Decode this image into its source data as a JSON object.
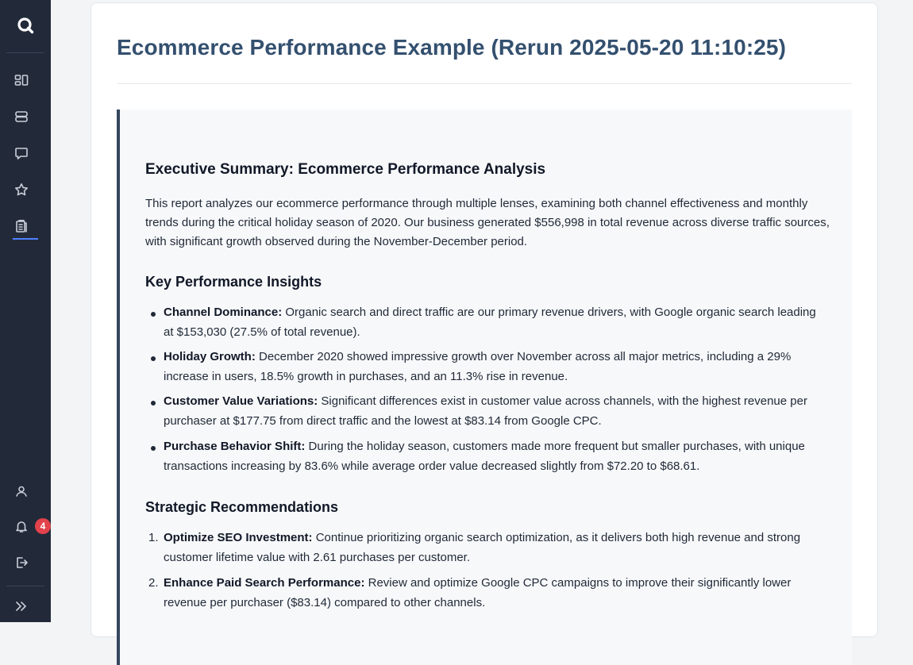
{
  "sidebar": {
    "items": [
      {
        "name": "dashboard-icon"
      },
      {
        "name": "database-icon"
      },
      {
        "name": "chat-icon"
      },
      {
        "name": "star-icon"
      },
      {
        "name": "reports-icon"
      }
    ],
    "bottom": [
      {
        "name": "user-icon"
      },
      {
        "name": "bell-icon"
      },
      {
        "name": "logout-icon"
      },
      {
        "name": "expand-icon"
      }
    ],
    "notification_count": "4",
    "accent_color": "#4f7fff"
  },
  "page": {
    "title": "Ecommerce Performance Example (Rerun 2025-05-20 11:10:25)"
  },
  "report": {
    "summary_heading": "Executive Summary: Ecommerce Performance Analysis",
    "summary_text": "This report analyzes our ecommerce performance through multiple lenses, examining both channel effectiveness and monthly trends during the critical holiday season of 2020. Our business generated $556,998 in total revenue across diverse traffic sources, with significant growth observed during the November-December period.",
    "insights_heading": "Key Performance Insights",
    "insights": [
      {
        "lead": "Channel Dominance:",
        "text": " Organic search and direct traffic are our primary revenue drivers, with Google organic search leading at $153,030 (27.5% of total revenue)."
      },
      {
        "lead": "Holiday Growth:",
        "text": " December 2020 showed impressive growth over November across all major metrics, including a 29% increase in users, 18.5% growth in purchases, and an 11.3% rise in revenue."
      },
      {
        "lead": "Customer Value Variations:",
        "text": " Significant differences exist in customer value across channels, with the highest revenue per purchaser at $177.75 from direct traffic and the lowest at $83.14 from Google CPC."
      },
      {
        "lead": "Purchase Behavior Shift:",
        "text": " During the holiday season, customers made more frequent but smaller purchases, with unique transactions increasing by 83.6% while average order value decreased slightly from $72.20 to $68.61."
      }
    ],
    "recommendations_heading": "Strategic Recommendations",
    "recommendations": [
      {
        "num": "1.",
        "lead": "Optimize SEO Investment:",
        "text": " Continue prioritizing organic search optimization, as it delivers both high revenue and strong customer lifetime value with 2.61 purchases per customer."
      },
      {
        "num": "2.",
        "lead": "Enhance Paid Search Performance:",
        "text": " Review and optimize Google CPC campaigns to improve their significantly lower revenue per purchaser ($83.14) compared to other channels."
      }
    ]
  }
}
